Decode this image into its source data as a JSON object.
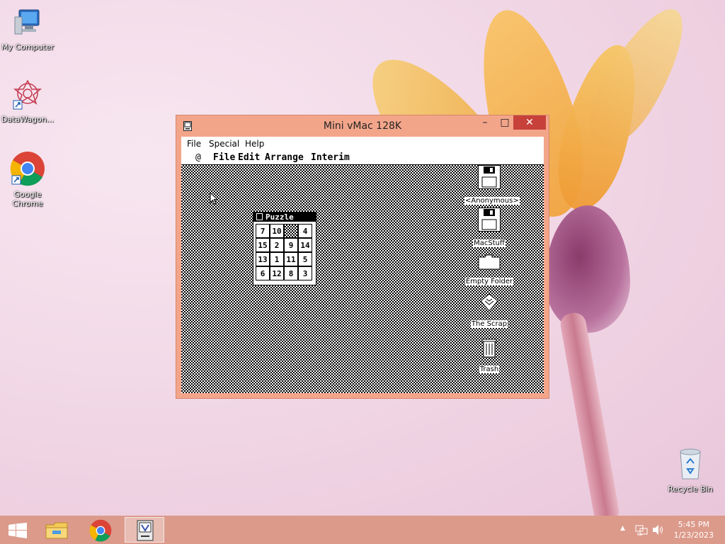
{
  "desktop": {
    "icons": [
      {
        "label": "My Computer",
        "icon": "computer-icon"
      },
      {
        "label": "DataWagon...",
        "icon": "datawagon-icon"
      },
      {
        "label": "Google Chrome",
        "icon": "chrome-icon"
      },
      {
        "label": "Recycle Bin",
        "icon": "recycle-bin-icon"
      }
    ]
  },
  "window": {
    "title": "Mini vMac 128K",
    "menu": [
      "File",
      "Special",
      "Help"
    ],
    "controls": {
      "minimize": "–",
      "maximize": "□",
      "close": "✕"
    }
  },
  "mac": {
    "menubar": {
      "apple": "@",
      "items": [
        "File",
        "Edit",
        "Arrange",
        "Interim"
      ]
    },
    "icons": [
      {
        "label": "<Anonymous>",
        "icon": "disk-icon"
      },
      {
        "label": "MacStuff",
        "icon": "disk-icon"
      },
      {
        "label": "Empty Folder",
        "icon": "folder-icon"
      },
      {
        "label": "The Scrap",
        "icon": "scrapbook-icon"
      },
      {
        "label": "Trash",
        "icon": "trash-icon"
      }
    ],
    "puzzle": {
      "title": "Puzzle",
      "tiles": [
        "7",
        "10",
        "",
        "4",
        "15",
        "2",
        "9",
        "14",
        "13",
        "1",
        "11",
        "5",
        "6",
        "12",
        "8",
        "3"
      ]
    }
  },
  "taskbar": {
    "time": "5:45 PM",
    "date": "1/23/2023",
    "colors": {
      "taskbar": "#dc9a8b",
      "close": "#c7413a",
      "window": "#f3a58a"
    }
  }
}
